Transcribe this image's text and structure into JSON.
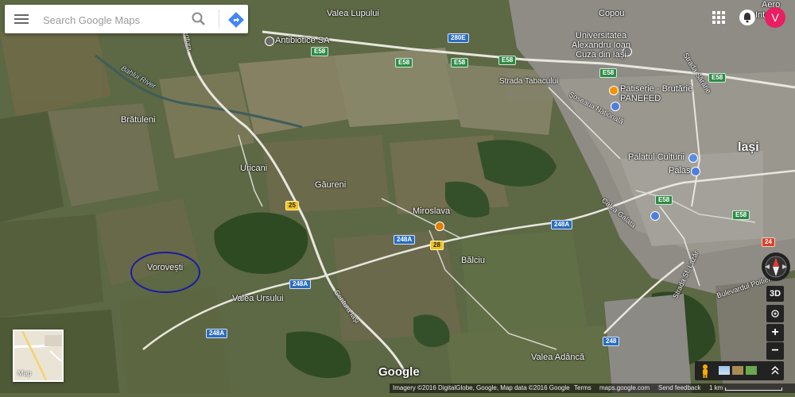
{
  "search": {
    "placeholder": "Search Google Maps"
  },
  "header": {
    "avatar_letter": "V",
    "top_right_label": "Inte"
  },
  "places": {
    "towns": [
      "Iași",
      "Uricani",
      "Găureni",
      "Miroslava",
      "Bălciu",
      "Brătuleni",
      "Vorovești",
      "Valea Ursului",
      "Valea Adâncă",
      "Valea Lupului",
      "Copou",
      "Aero"
    ],
    "river": "Bahlui River",
    "streets": [
      "Strada Tabacului",
      "Șoseaua Națională",
      "Bulevardul Poitiers",
      "Centura Iași",
      "Strada Sărărie",
      "Calea Galata",
      "Strada Sf. Lazăr",
      "Centura"
    ],
    "pois": [
      "Antibiotice SA",
      "Universitatea Alexandru Ioan Cuza din Iași",
      "Patiserie - Brutărie PANEFED",
      "Palatul Culturii",
      "Palas"
    ]
  },
  "shields": {
    "e58": "E58",
    "r280e": "280E",
    "r248a": "248A",
    "r248": "248",
    "r25": "25",
    "r28": "28",
    "r24": "24"
  },
  "controls": {
    "threed": "3D",
    "zoom_in": "+",
    "zoom_out": "−",
    "minimap_label": "Map"
  },
  "branding": {
    "logo": "Google"
  },
  "footer": {
    "imagery": "Imagery ©2016 DigitalGlobe, Google, Map data ©2016 Google",
    "terms": "Terms",
    "site": "maps.google.com",
    "feedback": "Send feedback",
    "scale": "1 km"
  },
  "annotation": {
    "circle_color": "#1a1aa0"
  },
  "colors": {
    "e_road": "#2f8a46",
    "national_road": "#2b6dbf",
    "county_road": "#f3c21b",
    "accent_avatar": "#e91e63",
    "directions_blue": "#4285f4"
  }
}
